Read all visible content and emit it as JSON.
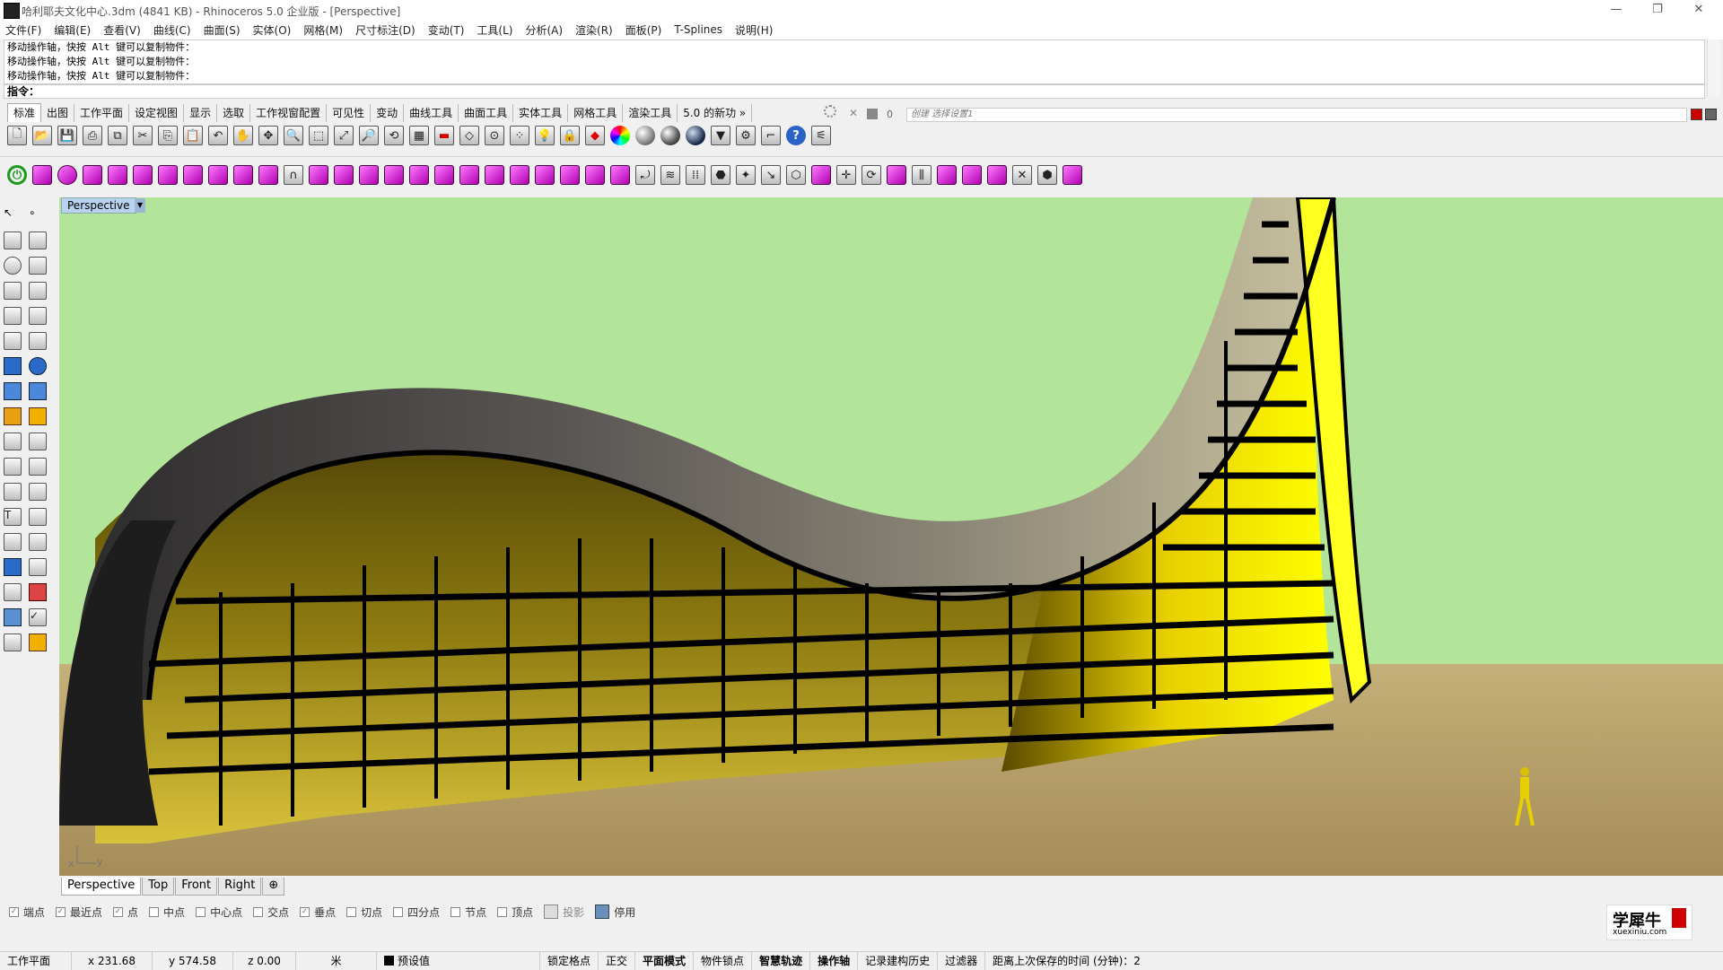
{
  "window": {
    "title": "哈利耶夫文化中心.3dm (4841 KB) - Rhinoceros  5.0 企业版 - [Perspective]",
    "controls": [
      "—",
      "❐",
      "✕"
    ]
  },
  "menu": [
    "文件(F)",
    "编辑(E)",
    "查看(V)",
    "曲线(C)",
    "曲面(S)",
    "实体(O)",
    "网格(M)",
    "尺寸标注(D)",
    "变动(T)",
    "工具(L)",
    "分析(A)",
    "渲染(R)",
    "面板(P)",
    "T-Splines",
    "说明(H)"
  ],
  "command": {
    "history": [
      "移动操作轴，快按 Alt 键可以复制物件：",
      "移动操作轴，快按 Alt 键可以复制物件：",
      "移动操作轴，快按 Alt 键可以复制物件："
    ],
    "prompt": "指令："
  },
  "toolbar_tabs": [
    "标准",
    "出图",
    "工作平面",
    "设定视图",
    "显示",
    "选取",
    "工作视窗配置",
    "可见性",
    "变动",
    "曲线工具",
    "曲面工具",
    "实体工具",
    "网格工具",
    "渲染工具",
    "5.0 的新功 »"
  ],
  "right_panel": {
    "close": "✕",
    "count": "0",
    "layer_text": "创建 选择设置1"
  },
  "viewport": {
    "label": "Perspective",
    "axis_x": "x",
    "axis_y": "y"
  },
  "view_tabs": [
    "Perspective",
    "Top",
    "Front",
    "Right",
    "⊕"
  ],
  "osnap": [
    {
      "label": "端点",
      "checked": true
    },
    {
      "label": "最近点",
      "checked": true
    },
    {
      "label": "点",
      "checked": true
    },
    {
      "label": "中点",
      "checked": false
    },
    {
      "label": "中心点",
      "checked": false
    },
    {
      "label": "交点",
      "checked": false
    },
    {
      "label": "垂点",
      "checked": true
    },
    {
      "label": "切点",
      "checked": false
    },
    {
      "label": "四分点",
      "checked": false
    },
    {
      "label": "节点",
      "checked": false
    },
    {
      "label": "顶点",
      "checked": false
    },
    {
      "label": "投影",
      "checked": false
    },
    {
      "label": "停用",
      "checked": false
    }
  ],
  "status": {
    "cplane": "工作平面",
    "x": "x 231.68",
    "y": "y 574.58",
    "z": "z 0.00",
    "unit": "米",
    "layer": "预设值",
    "grid_snap": "锁定格点",
    "ortho": "正交",
    "planar": "平面模式",
    "osnap": "物件锁点",
    "smarttrack": "智慧轨迹",
    "gumball": "操作轴",
    "history": "记录建构历史",
    "filter": "过滤器",
    "save_time": "距离上次保存的时间 (分钟)：2"
  },
  "watermark": {
    "text": "学犀牛",
    "url": "xuexiniu.com"
  },
  "colors": {
    "sky": "#b2e59a",
    "facade": "#ffff00",
    "roof": "#3a3838",
    "ground": "#b8a574"
  }
}
